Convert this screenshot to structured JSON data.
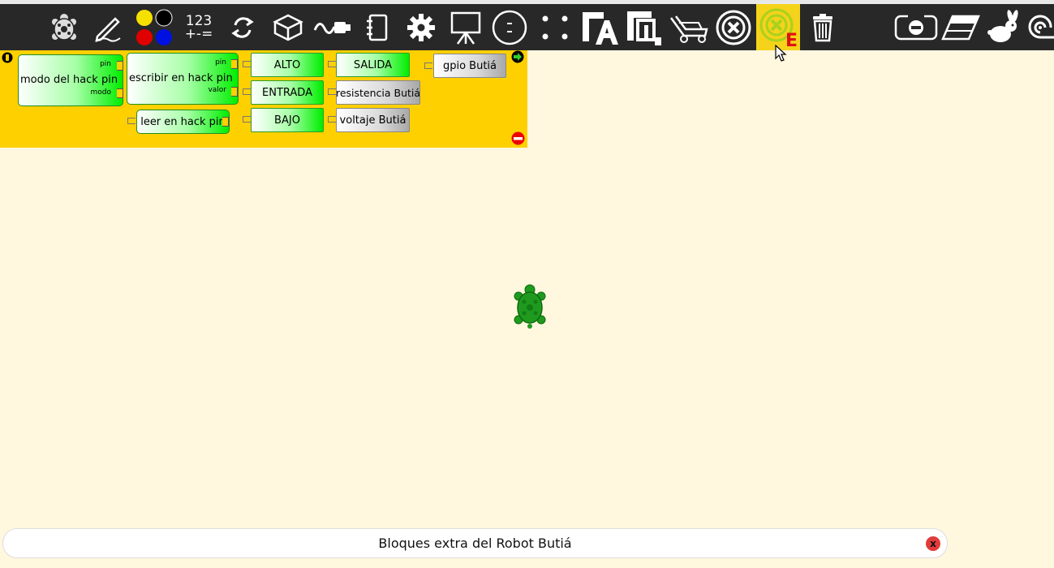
{
  "toolbar": {
    "numbers_label": "123",
    "operators_label": "+-=",
    "buttons": [
      "turtle-palette",
      "pen-palette",
      "colors-palette",
      "numbers-palette",
      "flow-palette",
      "blocks-palette",
      "sensors-palette",
      "media-palette",
      "extras-palette",
      "presentation-palette",
      "portfolio-palette",
      "dots-palette",
      "font-palette",
      "butia-palette",
      "cart-palette",
      "stop-palette",
      "butia-extra-palette",
      "trash-palette",
      "hide-blocks",
      "erase",
      "rabbit-run",
      "snail-run"
    ],
    "colors": {
      "bar": "#282828",
      "active": "#f5d31a"
    }
  },
  "palette": {
    "background": "#ffd000",
    "blocks": {
      "modo_label": "modo del hack pin",
      "modo_pin": "pin",
      "modo_modo": "modo",
      "escribir_label": "escribir en hack pin",
      "escribir_pin": "pin",
      "escribir_valor": "valor",
      "leer_label": "leer en hack pin",
      "alto": "ALTO",
      "entrada": "ENTRADA",
      "bajo": "BAJO",
      "salida": "SALIDA",
      "resistencia": "resistencia Butiá",
      "voltaje": "voltaje Butiá",
      "gpio": "gpio Butiá"
    }
  },
  "canvas": {
    "background": "#fff7de",
    "turtle_color": "#1f9a1f"
  },
  "status": {
    "message": "Bloques extra del Robot Butiá",
    "close": "x"
  }
}
